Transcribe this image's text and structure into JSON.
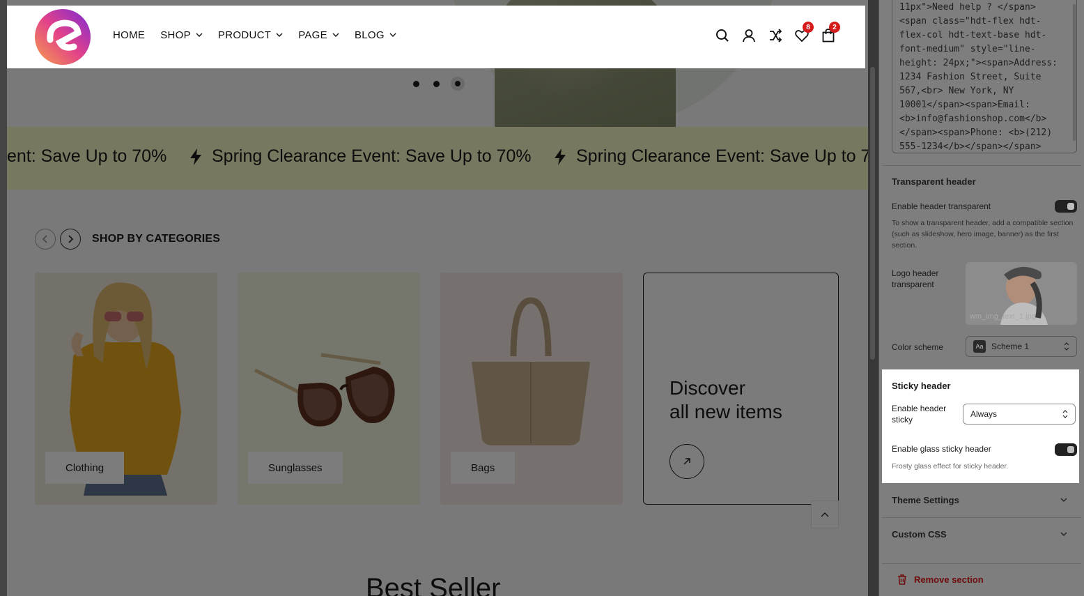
{
  "header": {
    "nav": [
      {
        "label": "HOME",
        "has_dropdown": false
      },
      {
        "label": "SHOP",
        "has_dropdown": true
      },
      {
        "label": "PRODUCT",
        "has_dropdown": true
      },
      {
        "label": "PAGE",
        "has_dropdown": true
      },
      {
        "label": "BLOG",
        "has_dropdown": true
      }
    ],
    "icons": [
      "search-icon",
      "account-icon",
      "compare-icon",
      "wishlist-icon",
      "cart-icon"
    ],
    "wishlist_count": "8",
    "cart_count": "2"
  },
  "hero": {
    "slide_count": 3,
    "active_slide": 3
  },
  "marquee": {
    "items": [
      "ent: Save Up to 70%",
      "Spring Clearance Event: Save Up to 70%",
      "Spring Clearance Event: Save Up to 70"
    ],
    "background": "#eff1bf"
  },
  "categories": {
    "title": "SHOP BY CATEGORIES",
    "cards": [
      {
        "label": "Clothing",
        "bg": "#e9e2d6"
      },
      {
        "label": "Sunglasses",
        "bg": "#eaecd8"
      },
      {
        "label": "Bags",
        "bg": "#ece1df"
      }
    ],
    "discover": {
      "line1": "Discover",
      "line2": "all new items"
    }
  },
  "best_seller_title": "Best Seller",
  "panel": {
    "code_text": "11px\">Need help ? </span>\n<span class=\"hdt-flex hdt-\nflex-col hdt-text-base hdt-\nfont-medium\" style=\"line-\nheight: 24px;\"><span>Address:\n1234 Fashion Street, Suite\n567,<br> New York, NY\n10001</span><span>Email:\n<b>info@fashionshop.com</b>\n</span><span>Phone: <b>(212)\n555-1234</b></span></span>",
    "transparent_header": {
      "title": "Transparent header",
      "enable_label": "Enable header transparent",
      "enabled": true,
      "help": "To show a transparent header, add a compatible section (such as slideshow, hero image, banner) as the first section.",
      "logo_label": "Logo header transparent",
      "logo_file": "wm_img_text_1.jpg",
      "color_scheme_label": "Color scheme",
      "color_scheme_value": "Scheme 1",
      "color_scheme_icon": "Aa"
    },
    "sticky_header": {
      "title": "Sticky header",
      "enable_label": "Enable header sticky",
      "enable_value": "Always",
      "glass_label": "Enable glass sticky header",
      "glass_enabled": true,
      "glass_help": "Frosty glass effect for sticky header."
    },
    "theme_settings_label": "Theme Settings",
    "custom_css_label": "Custom CSS",
    "remove_section_label": "Remove section"
  }
}
